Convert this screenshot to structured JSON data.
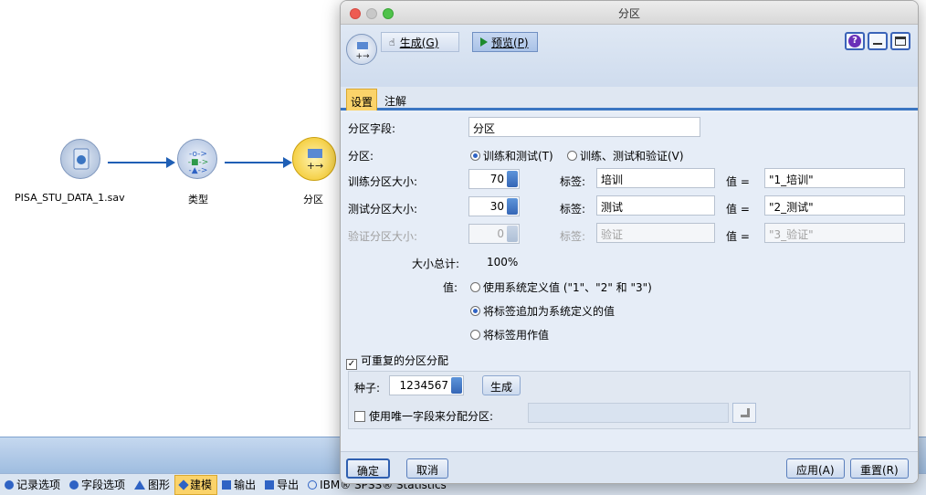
{
  "canvas": {
    "nodes": [
      {
        "label": "PISA_STU_DATA_1.sav"
      },
      {
        "label": "类型"
      },
      {
        "label": "分区"
      }
    ]
  },
  "palette_tabs": [
    {
      "label": "记录选项",
      "color": "#2f63c4"
    },
    {
      "label": "字段选项",
      "color": "#2f63c4"
    },
    {
      "label": "图形",
      "color": "#2f63c4"
    },
    {
      "label": "建模",
      "color": "#2f63c4",
      "active": true
    },
    {
      "label": "输出",
      "color": "#2f63c4"
    },
    {
      "label": "导出",
      "color": "#2f63c4"
    },
    {
      "label": "IBM® SPSS® Statistics",
      "color": "#2f63c4"
    }
  ],
  "dialog": {
    "title": "分区",
    "toolbar": {
      "generate_label": "生成(G)",
      "preview_label": "预览(P)"
    },
    "tabs": [
      {
        "label": "设置",
        "active": true
      },
      {
        "label": "注解",
        "active": false
      }
    ],
    "form": {
      "field_label": "分区字段:",
      "field_value": "分区",
      "partition_label": "分区:",
      "partition_option_1": "训练和测试(T)",
      "partition_option_2": "训练、测试和验证(V)",
      "rows": [
        {
          "label": "训练分区大小:",
          "size": "70",
          "tag_label": "标签:",
          "tag": "培训",
          "value_label": "值 =",
          "value": "\"1_培训\"",
          "disabled": false
        },
        {
          "label": "测试分区大小:",
          "size": "30",
          "tag_label": "标签:",
          "tag": "测试",
          "value_label": "值 =",
          "value": "\"2_测试\"",
          "disabled": false
        },
        {
          "label": "验证分区大小:",
          "size": "0",
          "tag_label": "标签:",
          "tag": "验证",
          "value_label": "值 =",
          "value": "\"3_验证\"",
          "disabled": true
        }
      ],
      "total_label": "大小总计:",
      "total_value": "100%",
      "values_label": "值:",
      "values_options": [
        {
          "label": "使用系统定义值 (\"1\"、\"2\" 和 \"3\")",
          "selected": false
        },
        {
          "label": "将标签追加为系统定义的值",
          "selected": true
        },
        {
          "label": "将标签用作值",
          "selected": false
        }
      ],
      "repeatable_label": "可重复的分区分配",
      "repeatable_checked": true,
      "seed_label": "种子:",
      "seed_value": "1234567",
      "seed_generate_label": "生成",
      "unique_field_label": "使用唯一字段来分配分区:",
      "unique_field_checked": false
    },
    "footer": {
      "ok": "确定",
      "cancel": "取消",
      "apply": "应用(A)",
      "reset": "重置(R)"
    }
  }
}
